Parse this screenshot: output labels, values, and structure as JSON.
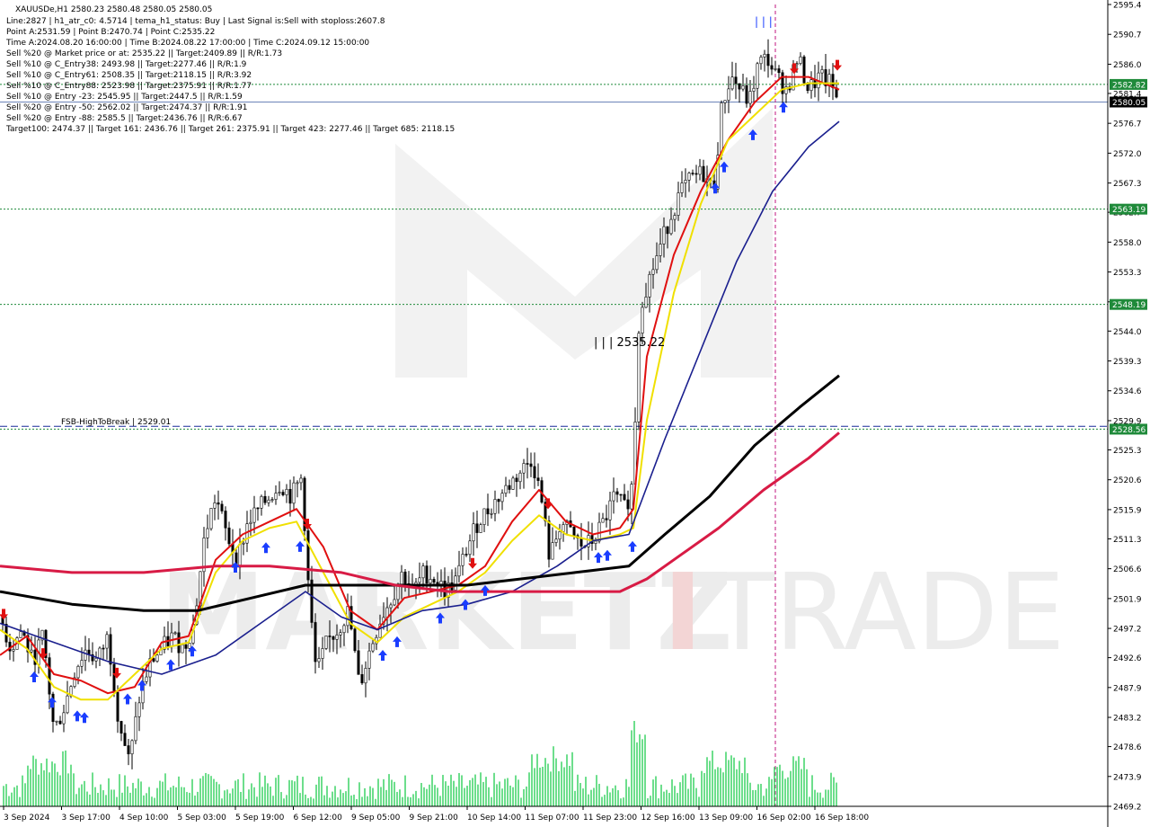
{
  "header": {
    "lines": [
      "XAUUSDe,H1  2580.23 2580.48 2580.05 2580.05",
      "Line:2827  |  h1_atr_c0: 4.5714  |  tema_h1_status: Buy  |  Last Signal is:Sell with stoploss:2607.8",
      "Point A:2531.59  |  Point B:2470.74  |  Point C:2535.22",
      "Time A:2024.08.20 16:00:00  |  Time B:2024.08.22 17:00:00  |  Time C:2024.09.12 15:00:00",
      "Sell %20 @ Market price or at: 2535.22  ||  Target:2409.89  ||  R/R:1.73",
      "Sell %10 @ C_Entry38: 2493.98  ||  Target:2277.46  ||  R/R:1.9",
      "Sell %10 @ C_Entry61: 2508.35  ||  Target:2118.15  ||  R/R:3.92",
      "Sell %10 @ C_Entry88: 2523.98  ||  Target:2375.91  ||  R/R:1.77",
      "Sell %10 @ Entry -23: 2545.95  ||  Target:2447.5  ||  R/R:1.59",
      "Sell %20 @ Entry -50: 2562.02  ||  Target:2474.37  ||  R/R:1.91",
      "Sell %20 @ Entry -88: 2585.5  ||  Target:2436.76  ||  R/R:6.67",
      "Target100: 2474.37  ||  Target 161: 2436.76  ||  Target 261: 2375.91  ||  Target 423: 2277.46  ||  Target 685: 2118.15"
    ]
  },
  "annotations": {
    "point_c_label": "| | | 2535.22",
    "fsb_label": "FSB-HighToBreak  |  2529.01",
    "top_marker": "| | |"
  },
  "watermark": {
    "text1": "MARKETZ",
    "text2": "I",
    "text3": "TRADE"
  },
  "chart_data": {
    "type": "candlestick",
    "symbol": "XAUUSDe",
    "timeframe": "H1",
    "ylim": [
      2469.2,
      2595.4
    ],
    "y_ticks": [
      2595.4,
      2590.7,
      2586.0,
      2581.4,
      2576.7,
      2572.0,
      2567.3,
      2562.7,
      2558.0,
      2553.3,
      2548.6,
      2544.0,
      2539.3,
      2534.6,
      2529.9,
      2525.3,
      2520.6,
      2515.9,
      2511.3,
      2506.6,
      2501.9,
      2497.2,
      2492.6,
      2487.9,
      2483.2,
      2478.6,
      2473.9,
      2469.2
    ],
    "x_labels": [
      "3 Sep 2024",
      "3 Sep 17:00",
      "4 Sep 10:00",
      "5 Sep 03:00",
      "5 Sep 19:00",
      "6 Sep 12:00",
      "9 Sep 05:00",
      "9 Sep 21:00",
      "10 Sep 14:00",
      "11 Sep 07:00",
      "11 Sep 23:00",
      "12 Sep 16:00",
      "13 Sep 09:00",
      "16 Sep 02:00",
      "16 Sep 18:00"
    ],
    "current_price": 2580.05,
    "levels": [
      {
        "value": 2582.82,
        "label": "2582.82",
        "color": "#1f8a3a",
        "style": "dotted"
      },
      {
        "value": 2563.19,
        "label": "2563.19",
        "color": "#1f8a3a",
        "style": "dotted"
      },
      {
        "value": 2548.19,
        "label": "2548.19",
        "color": "#1f8a3a",
        "style": "dotted"
      },
      {
        "value": 2529.01,
        "label": "2529.01",
        "color": "#1a2a9c",
        "style": "dashed"
      },
      {
        "value": 2528.56,
        "label": "2528.56",
        "color": "#1f8a3a",
        "style": "dotted"
      },
      {
        "value": 2580.05,
        "label": "2580.05",
        "color": "#6c84b8",
        "style": "solid"
      }
    ],
    "series": [
      {
        "name": "close",
        "points": [
          [
            0,
            2499
          ],
          [
            12,
            2494
          ],
          [
            24,
            2497
          ],
          [
            36,
            2492
          ],
          [
            48,
            2496
          ],
          [
            60,
            2481
          ],
          [
            72,
            2485
          ],
          [
            84,
            2491
          ],
          [
            96,
            2494
          ],
          [
            108,
            2492
          ],
          [
            120,
            2496
          ],
          [
            132,
            2483
          ],
          [
            144,
            2476
          ],
          [
            156,
            2487
          ],
          [
            168,
            2492
          ],
          [
            180,
            2494
          ],
          [
            192,
            2496
          ],
          [
            204,
            2494
          ],
          [
            216,
            2498
          ],
          [
            228,
            2512
          ],
          [
            240,
            2518
          ],
          [
            252,
            2512
          ],
          [
            264,
            2508
          ],
          [
            276,
            2514
          ],
          [
            288,
            2516
          ],
          [
            300,
            2518
          ],
          [
            312,
            2520
          ],
          [
            324,
            2518
          ],
          [
            336,
            2521
          ],
          [
            344,
            2502
          ],
          [
            352,
            2490
          ],
          [
            364,
            2495
          ],
          [
            376,
            2497
          ],
          [
            388,
            2500
          ],
          [
            400,
            2488
          ],
          [
            412,
            2494
          ],
          [
            424,
            2499
          ],
          [
            436,
            2502
          ],
          [
            448,
            2506
          ],
          [
            460,
            2503
          ],
          [
            472,
            2506
          ],
          [
            484,
            2505
          ],
          [
            496,
            2503
          ],
          [
            508,
            2505
          ],
          [
            520,
            2510
          ],
          [
            532,
            2514
          ],
          [
            544,
            2516
          ],
          [
            556,
            2518
          ],
          [
            568,
            2520
          ],
          [
            580,
            2522
          ],
          [
            592,
            2524
          ],
          [
            602,
            2518
          ],
          [
            612,
            2508
          ],
          [
            624,
            2514
          ],
          [
            636,
            2512
          ],
          [
            648,
            2510
          ],
          [
            660,
            2511
          ],
          [
            672,
            2514
          ],
          [
            684,
            2518
          ],
          [
            696,
            2516
          ],
          [
            704,
            2520
          ],
          [
            712,
            2548
          ],
          [
            722,
            2552
          ],
          [
            734,
            2557
          ],
          [
            746,
            2562
          ],
          [
            758,
            2566
          ],
          [
            770,
            2568
          ],
          [
            782,
            2569
          ],
          [
            794,
            2566
          ],
          [
            804,
            2580
          ],
          [
            814,
            2584
          ],
          [
            824,
            2582
          ],
          [
            834,
            2580
          ],
          [
            844,
            2586
          ],
          [
            854,
            2587
          ],
          [
            864,
            2584
          ],
          [
            876,
            2582
          ],
          [
            888,
            2587
          ],
          [
            900,
            2582
          ],
          [
            912,
            2584
          ],
          [
            924,
            2583
          ],
          [
            934,
            2580
          ]
        ],
        "color": "#000000"
      },
      {
        "name": "ema_fast",
        "points": [
          [
            0,
            2493
          ],
          [
            30,
            2496
          ],
          [
            60,
            2490
          ],
          [
            90,
            2489
          ],
          [
            120,
            2487
          ],
          [
            150,
            2488
          ],
          [
            180,
            2495
          ],
          [
            210,
            2496
          ],
          [
            240,
            2508
          ],
          [
            270,
            2512
          ],
          [
            300,
            2514
          ],
          [
            330,
            2516
          ],
          [
            360,
            2510
          ],
          [
            390,
            2500
          ],
          [
            420,
            2497
          ],
          [
            450,
            2502
          ],
          [
            480,
            2503
          ],
          [
            510,
            2504
          ],
          [
            540,
            2507
          ],
          [
            570,
            2514
          ],
          [
            600,
            2519
          ],
          [
            630,
            2514
          ],
          [
            660,
            2512
          ],
          [
            690,
            2513
          ],
          [
            705,
            2516
          ],
          [
            720,
            2540
          ],
          [
            750,
            2556
          ],
          [
            780,
            2566
          ],
          [
            810,
            2574
          ],
          [
            840,
            2580
          ],
          [
            870,
            2584
          ],
          [
            900,
            2584
          ],
          [
            934,
            2582
          ]
        ],
        "color": "#e01010"
      },
      {
        "name": "tema",
        "points": [
          [
            0,
            2497
          ],
          [
            30,
            2494
          ],
          [
            60,
            2488
          ],
          [
            90,
            2486
          ],
          [
            120,
            2486
          ],
          [
            150,
            2490
          ],
          [
            180,
            2494
          ],
          [
            210,
            2495
          ],
          [
            240,
            2506
          ],
          [
            270,
            2511
          ],
          [
            300,
            2513
          ],
          [
            330,
            2514
          ],
          [
            360,
            2506
          ],
          [
            390,
            2498
          ],
          [
            420,
            2495
          ],
          [
            450,
            2499
          ],
          [
            480,
            2501
          ],
          [
            510,
            2503
          ],
          [
            540,
            2506
          ],
          [
            570,
            2511
          ],
          [
            600,
            2515
          ],
          [
            630,
            2512
          ],
          [
            660,
            2511
          ],
          [
            690,
            2512
          ],
          [
            705,
            2513
          ],
          [
            720,
            2530
          ],
          [
            750,
            2550
          ],
          [
            780,
            2564
          ],
          [
            810,
            2574
          ],
          [
            840,
            2578
          ],
          [
            870,
            2582
          ],
          [
            900,
            2583
          ],
          [
            934,
            2583
          ]
        ],
        "color": "#f0e000"
      },
      {
        "name": "ma_mid",
        "points": [
          [
            0,
            2498
          ],
          [
            60,
            2495
          ],
          [
            120,
            2492
          ],
          [
            180,
            2490
          ],
          [
            240,
            2493
          ],
          [
            300,
            2499
          ],
          [
            340,
            2503
          ],
          [
            380,
            2499
          ],
          [
            420,
            2497
          ],
          [
            470,
            2500
          ],
          [
            520,
            2501
          ],
          [
            570,
            2503
          ],
          [
            620,
            2507
          ],
          [
            660,
            2511
          ],
          [
            700,
            2512
          ],
          [
            740,
            2527
          ],
          [
            780,
            2541
          ],
          [
            820,
            2555
          ],
          [
            860,
            2566
          ],
          [
            900,
            2573
          ],
          [
            934,
            2577
          ]
        ],
        "color": "#1a1f8e"
      },
      {
        "name": "ma_slow",
        "points": [
          [
            0,
            2503
          ],
          [
            80,
            2501
          ],
          [
            160,
            2500
          ],
          [
            220,
            2500
          ],
          [
            280,
            2502
          ],
          [
            340,
            2504
          ],
          [
            400,
            2504
          ],
          [
            460,
            2504
          ],
          [
            520,
            2504
          ],
          [
            580,
            2505
          ],
          [
            640,
            2506
          ],
          [
            700,
            2507
          ],
          [
            740,
            2512
          ],
          [
            790,
            2518
          ],
          [
            840,
            2526
          ],
          [
            890,
            2532
          ],
          [
            934,
            2537
          ]
        ],
        "color": "#000000"
      },
      {
        "name": "ma_long",
        "points": [
          [
            0,
            2507
          ],
          [
            80,
            2506
          ],
          [
            160,
            2506
          ],
          [
            240,
            2507
          ],
          [
            300,
            2507
          ],
          [
            380,
            2506
          ],
          [
            440,
            2504
          ],
          [
            500,
            2503
          ],
          [
            560,
            2503
          ],
          [
            620,
            2503
          ],
          [
            690,
            2503
          ],
          [
            720,
            2505
          ],
          [
            760,
            2509
          ],
          [
            800,
            2513
          ],
          [
            850,
            2519
          ],
          [
            900,
            2524
          ],
          [
            934,
            2528
          ]
        ],
        "color": "#d81b45"
      }
    ]
  },
  "colors": {
    "up_arrow": "#1a3dff",
    "down_arrow": "#e01010",
    "volume": "#2fd05a",
    "vline": "#c0157f",
    "axis_text": "#000000",
    "current_price_bg": "#000000"
  }
}
